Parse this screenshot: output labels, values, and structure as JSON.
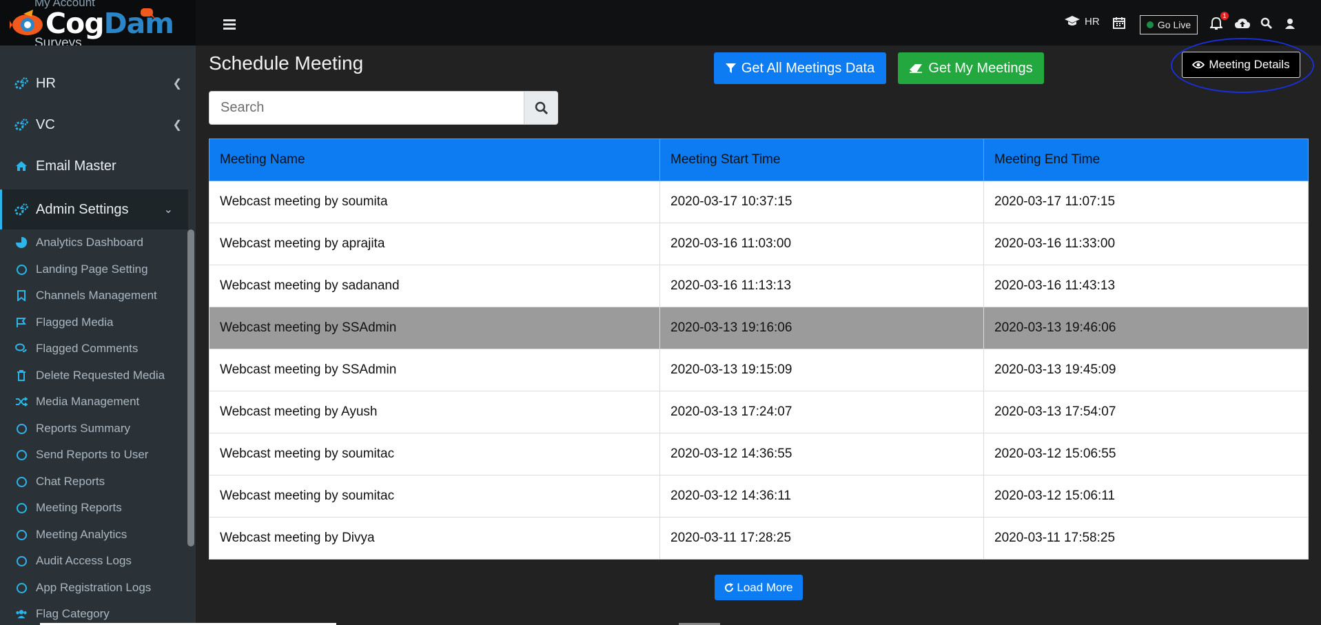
{
  "brand": {
    "logo_part1": "Cog",
    "logo_part2": "Dam",
    "hidden_top": "My Account",
    "hidden_item": "Surveys"
  },
  "topbar": {
    "hr_label": "HR",
    "golive_label": "Go Live",
    "notifications": "1"
  },
  "sidebar": {
    "items": [
      {
        "label": "HR",
        "icon": "gears-icon"
      },
      {
        "label": "VC",
        "icon": "gears-icon"
      },
      {
        "label": "Email Master",
        "icon": "home-icon"
      },
      {
        "label": "Admin Settings",
        "icon": "gears-icon"
      }
    ],
    "subitems": [
      {
        "label": "Analytics Dashboard",
        "icon": "pie-chart-icon"
      },
      {
        "label": "Landing Page Setting",
        "icon": "circle-icon"
      },
      {
        "label": "Channels Management",
        "icon": "bookmark-icon"
      },
      {
        "label": "Flagged Media",
        "icon": "flag-icon"
      },
      {
        "label": "Flagged Comments",
        "icon": "comments-icon"
      },
      {
        "label": "Delete Requested Media",
        "icon": "trash-icon"
      },
      {
        "label": "Media Management",
        "icon": "random-icon"
      },
      {
        "label": "Reports Summary",
        "icon": "circle-icon"
      },
      {
        "label": "Send Reports to User",
        "icon": "circle-icon"
      },
      {
        "label": "Chat Reports",
        "icon": "circle-icon"
      },
      {
        "label": "Meeting Reports",
        "icon": "circle-icon"
      },
      {
        "label": "Meeting Analytics",
        "icon": "circle-icon"
      },
      {
        "label": "Audit Access Logs",
        "icon": "circle-icon"
      },
      {
        "label": "App Registration Logs",
        "icon": "circle-icon"
      },
      {
        "label": "Flag Category",
        "icon": "users-icon"
      }
    ]
  },
  "main": {
    "title": "Schedule Meeting",
    "buttons": {
      "get_all": "Get All Meetings Data",
      "get_my": "Get My Meetings",
      "details": "Meeting Details",
      "load_more": "Load More"
    },
    "search": {
      "placeholder": "Search",
      "value": ""
    },
    "table": {
      "headers": [
        "Meeting Name",
        "Meeting Start Time",
        "Meeting End Time"
      ],
      "rows": [
        [
          "Webcast meeting by soumita",
          "2020-03-17 10:37:15",
          "2020-03-17 11:07:15"
        ],
        [
          "Webcast meeting by aprajita",
          "2020-03-16 11:03:00",
          "2020-03-16 11:33:00"
        ],
        [
          "Webcast meeting by sadanand",
          "2020-03-16 11:13:13",
          "2020-03-16 11:43:13"
        ],
        [
          "Webcast meeting by SSAdmin",
          "2020-03-13 19:16:06",
          "2020-03-13 19:46:06"
        ],
        [
          "Webcast meeting by SSAdmin",
          "2020-03-13 19:15:09",
          "2020-03-13 19:45:09"
        ],
        [
          "Webcast meeting by Ayush",
          "2020-03-13 17:24:07",
          "2020-03-13 17:54:07"
        ],
        [
          "Webcast meeting by soumitac",
          "2020-03-12 14:36:55",
          "2020-03-12 15:06:55"
        ],
        [
          "Webcast meeting by soumitac",
          "2020-03-12 14:36:11",
          "2020-03-12 15:06:11"
        ],
        [
          "Webcast meeting by Divya",
          "2020-03-11 17:28:25",
          "2020-03-11 17:58:25"
        ]
      ],
      "selected_row": 3
    }
  },
  "colors": {
    "primary": "#0d7bf2",
    "success": "#22a83f",
    "accent": "#2cb5e8",
    "annotation": "#1a2fd9"
  }
}
